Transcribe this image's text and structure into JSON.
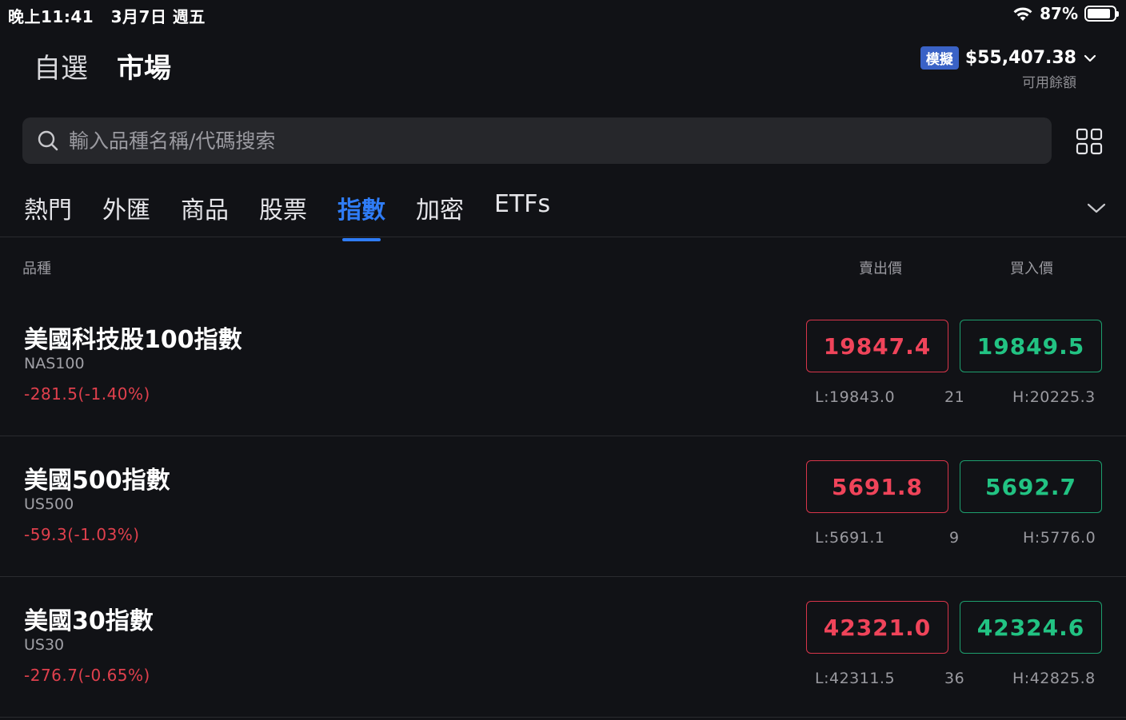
{
  "status_bar": {
    "time": "晚上11:41",
    "date": "3月7日 週五",
    "battery": "87%",
    "battery_level": 0.87
  },
  "header": {
    "nav": [
      "自選",
      "市場"
    ],
    "demo_badge": "模擬",
    "balance": "$55,407.38",
    "balance_caption": "可用餘額"
  },
  "search": {
    "placeholder": "輸入品種名稱/代碼搜索"
  },
  "tabs": [
    "熱門",
    "外匯",
    "商品",
    "股票",
    "指數",
    "加密",
    "ETFs"
  ],
  "active_tab": "指數",
  "columns": {
    "instrument": "品種",
    "sell": "賣出價",
    "buy": "買入價"
  },
  "instruments": [
    {
      "name": "美國科技股100指數",
      "code": "NAS100",
      "change": "-281.5(-1.40%)",
      "sell": "19847.4",
      "buy": "19849.5",
      "low": "L:19843.0",
      "spread": "21",
      "high": "H:20225.3"
    },
    {
      "name": "美國500指數",
      "code": "US500",
      "change": "-59.3(-1.03%)",
      "sell": "5691.8",
      "buy": "5692.7",
      "low": "L:5691.1",
      "spread": "9",
      "high": "H:5776.0"
    },
    {
      "name": "美國30指數",
      "code": "US30",
      "change": "-276.7(-0.65%)",
      "sell": "42321.0",
      "buy": "42324.6",
      "low": "L:42311.5",
      "spread": "36",
      "high": "H:42825.8"
    }
  ],
  "colors": {
    "accent": "#2f7cf6",
    "sell": "#f0445a",
    "buy": "#22c383",
    "background": "#111216"
  },
  "icons": [
    "wifi-icon",
    "battery-icon",
    "chevron-down-icon",
    "search-icon",
    "grid-icon"
  ]
}
